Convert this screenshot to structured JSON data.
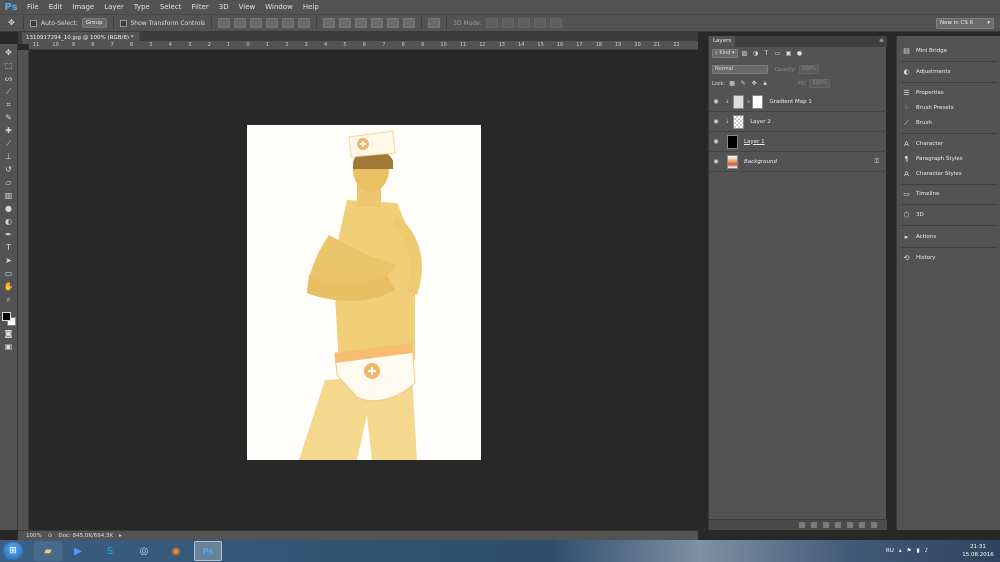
{
  "app": {
    "logo": "Ps",
    "menu": [
      "File",
      "Edit",
      "Image",
      "Layer",
      "Type",
      "Select",
      "Filter",
      "3D",
      "View",
      "Window",
      "Help"
    ]
  },
  "options_bar": {
    "auto_select_label": "Auto-Select:",
    "auto_select_value": "Group",
    "show_transform_label": "Show Transform Controls",
    "mode_3d_label": "3D Mode:",
    "workspace": "New in CS 6"
  },
  "document": {
    "tab_title": "1310917294_10.jpg @ 100% (RGB/8) *",
    "tab_close": "×",
    "ruler_h": [
      "11",
      "10",
      "9",
      "8",
      "7",
      "6",
      "5",
      "4",
      "3",
      "2",
      "1",
      "0",
      "1",
      "2",
      "3",
      "4",
      "5",
      "6",
      "7",
      "8",
      "9",
      "10",
      "11",
      "12",
      "13",
      "14",
      "15",
      "16",
      "17",
      "18",
      "19",
      "20",
      "21",
      "22"
    ]
  },
  "status": {
    "zoom": "100%",
    "doc": "Doc: 845,0K/694,3K"
  },
  "layers_panel": {
    "tab": "Layers",
    "filter": "Kind",
    "blend_mode": "Normal",
    "opacity_label": "Opacity:",
    "opacity_value": "100%",
    "lock_label": "Lock:",
    "fill_label": "Fill:",
    "fill_value": "100%",
    "layers": [
      {
        "name": "Gradient Map 1"
      },
      {
        "name": "Layer 2"
      },
      {
        "name": "Layer 1"
      },
      {
        "name": "Background"
      }
    ]
  },
  "dock": {
    "items": [
      "Mini Bridge",
      "Adjustments",
      "Properties",
      "Brush Presets",
      "Brush",
      "Character",
      "Paragraph Styles",
      "Character Styles",
      "Timeline",
      "3D",
      "Actions",
      "History"
    ]
  },
  "taskbar": {
    "lang": "RU",
    "time": "21:31",
    "date": "15.08.2016"
  },
  "colors": {
    "ui_gray": "#535353",
    "canvas_bg": "#282828",
    "skin_tint": "#f0cf78",
    "ps_blue": "#5aa8f0"
  }
}
